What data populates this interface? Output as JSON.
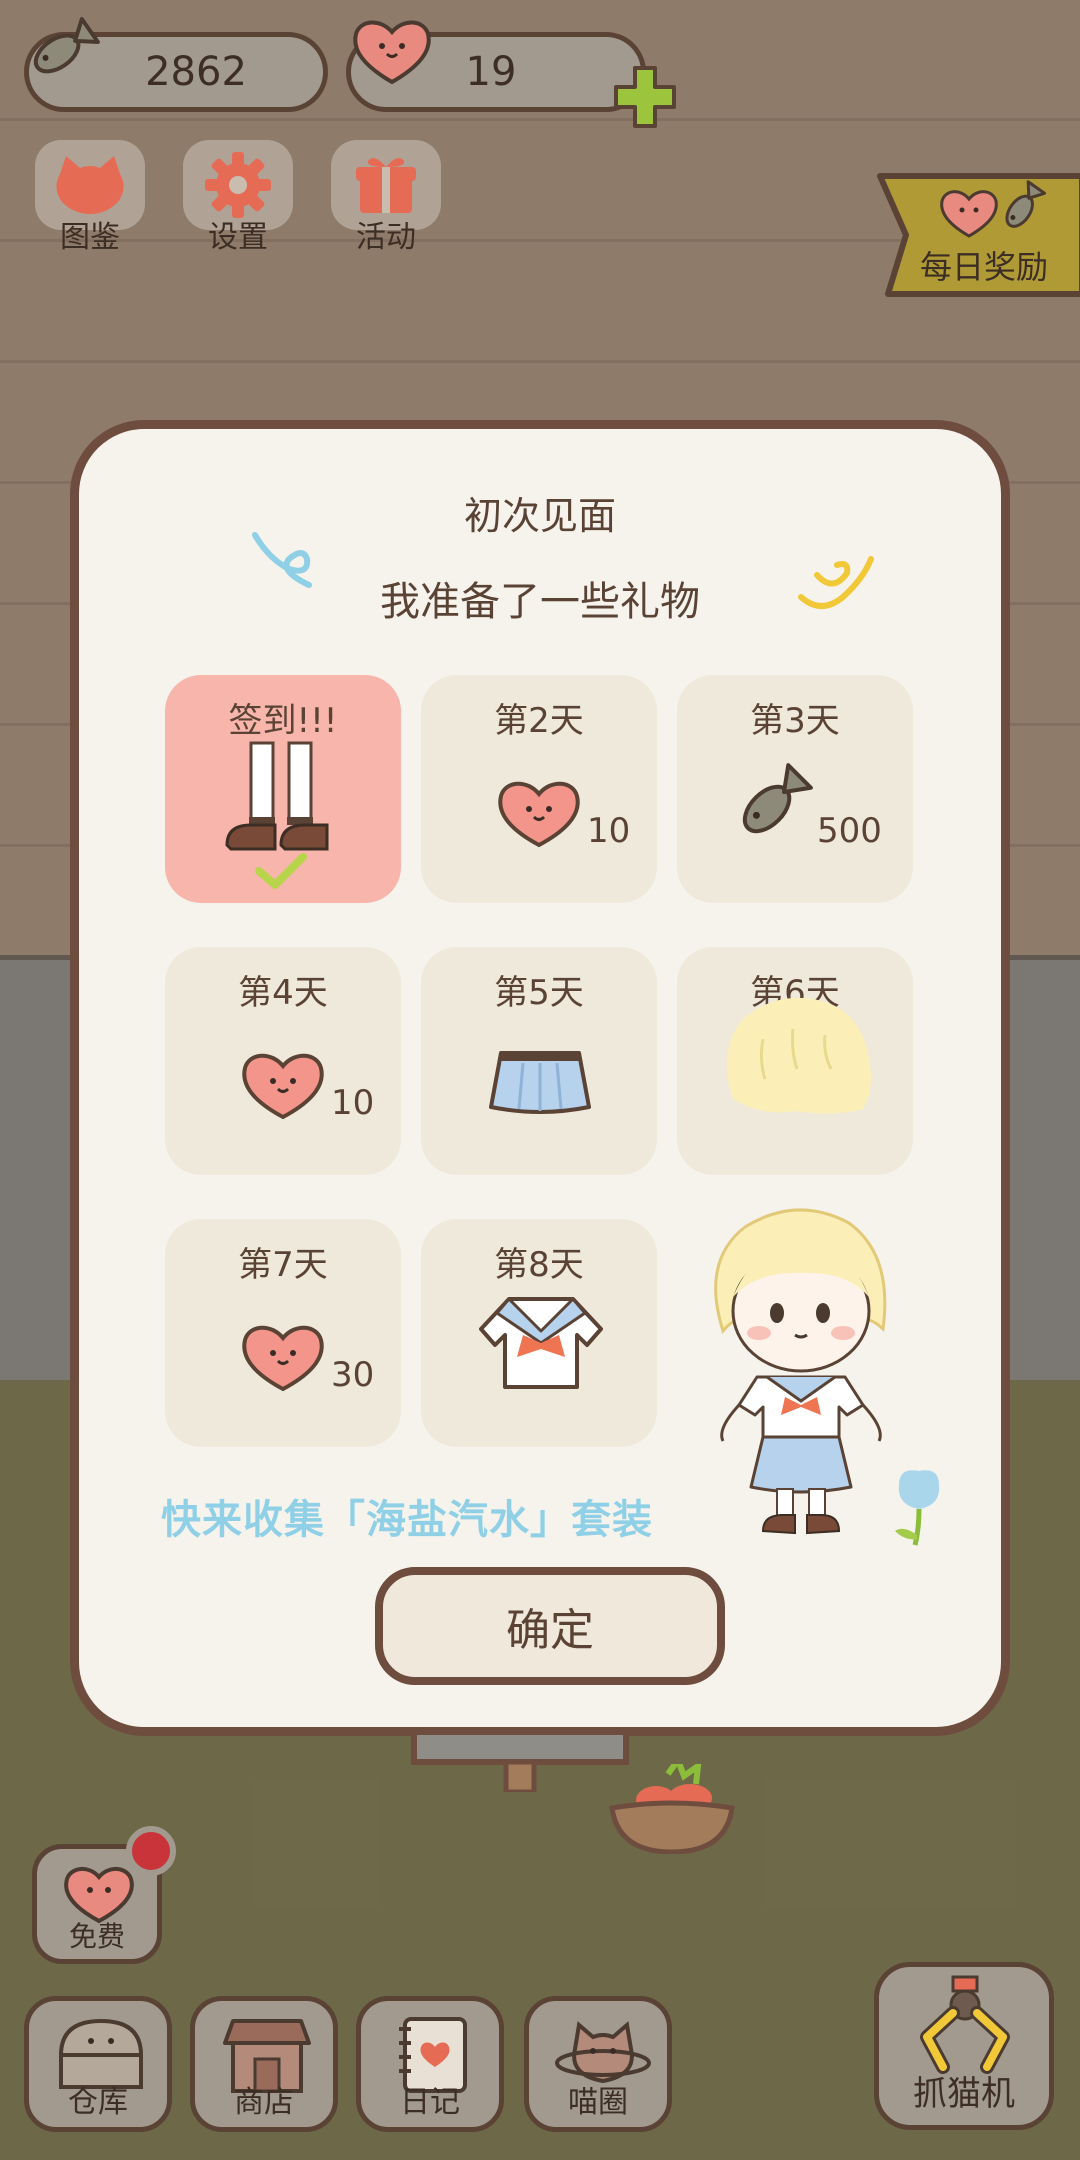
{
  "currency": {
    "fish": "2862",
    "hearts": "19"
  },
  "menu": [
    {
      "label": "图鉴",
      "icon": "cat-face-icon"
    },
    {
      "label": "设置",
      "icon": "gear-icon"
    },
    {
      "label": "活动",
      "icon": "gift-icon"
    }
  ],
  "daily_reward": {
    "label": "每日奖励"
  },
  "modal": {
    "title": "初次见面",
    "subtitle": "我准备了一些礼物",
    "days": [
      {
        "label": "签到!!!",
        "reward": "shoes",
        "qty": "",
        "claimed": true
      },
      {
        "label": "第2天",
        "reward": "heart",
        "qty": "10"
      },
      {
        "label": "第3天",
        "reward": "fish",
        "qty": "500"
      },
      {
        "label": "第4天",
        "reward": "heart",
        "qty": "10"
      },
      {
        "label": "第5天",
        "reward": "skirt",
        "qty": ""
      },
      {
        "label": "第6天",
        "reward": "hair",
        "qty": ""
      },
      {
        "label": "第7天",
        "reward": "heart",
        "qty": "30"
      },
      {
        "label": "第8天",
        "reward": "sailor-top",
        "qty": ""
      }
    ],
    "collect_text": "快来收集「海盐汽水」套装",
    "confirm": "确定"
  },
  "free": {
    "label": "免费"
  },
  "bottom_nav": [
    {
      "label": "仓库",
      "icon": "warehouse-icon"
    },
    {
      "label": "商店",
      "icon": "shop-icon"
    },
    {
      "label": "日记",
      "icon": "diary-icon"
    },
    {
      "label": "喵圈",
      "icon": "cat-planet-icon"
    }
  ],
  "claw": {
    "label": "抓猫机"
  },
  "colors": {
    "modal_bg": "#f6f3ed",
    "border": "#6e4d3e",
    "active_cell": "#f7b5ab",
    "cell": "#efe9db",
    "collect_text": "#8fd0e6",
    "heart": "#f08c82"
  }
}
